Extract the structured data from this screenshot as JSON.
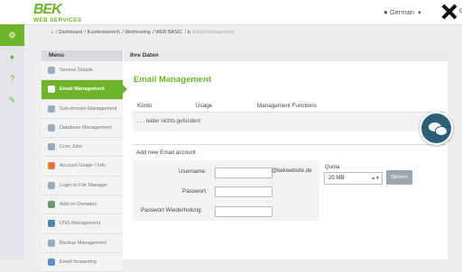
{
  "brand": {
    "logo": "BEK",
    "subtitle": "WEB SERVICES",
    "accent": "#6fb52c"
  },
  "header": {
    "language": "German",
    "close_partial": "C"
  },
  "rail_icons": [
    "gear-icon",
    "user-icon",
    "help-icon",
    "pencil-icon"
  ],
  "breadcrumb": {
    "items": [
      "Dashboard",
      "Kundenbereich",
      "Webhosting",
      "WEB BASIC",
      "b"
    ],
    "current": "Email Management"
  },
  "menu": {
    "title": "Menu",
    "items": [
      {
        "label": "Service Details"
      },
      {
        "label": "Email Management"
      },
      {
        "label": "Sub-domain Management"
      },
      {
        "label": "Database Management"
      },
      {
        "label": "Cron Jobs"
      },
      {
        "label": "Account Usage / Info"
      },
      {
        "label": "Login to File Manager"
      },
      {
        "label": "Add-on Domains"
      },
      {
        "label": "DNS Management"
      },
      {
        "label": "Backup Management"
      },
      {
        "label": "Email forwarding"
      }
    ],
    "active_index": 1
  },
  "main": {
    "header": "Ihre Daten",
    "title": "Email Management",
    "columns": [
      "Konto",
      "Usage",
      "Management Functions"
    ],
    "empty_message": ". . . leider nichts gefunden!",
    "add_header": "Add new Email account",
    "form": {
      "username_label": "Username:",
      "password_label": "Passwort:",
      "password_repeat_label": "Passwort Wiederholung:",
      "domain_suffix": "@bekwebsite.de",
      "quota_label": "Quota:",
      "quota_value": "20 MB",
      "submit_label": "Sichern"
    }
  }
}
